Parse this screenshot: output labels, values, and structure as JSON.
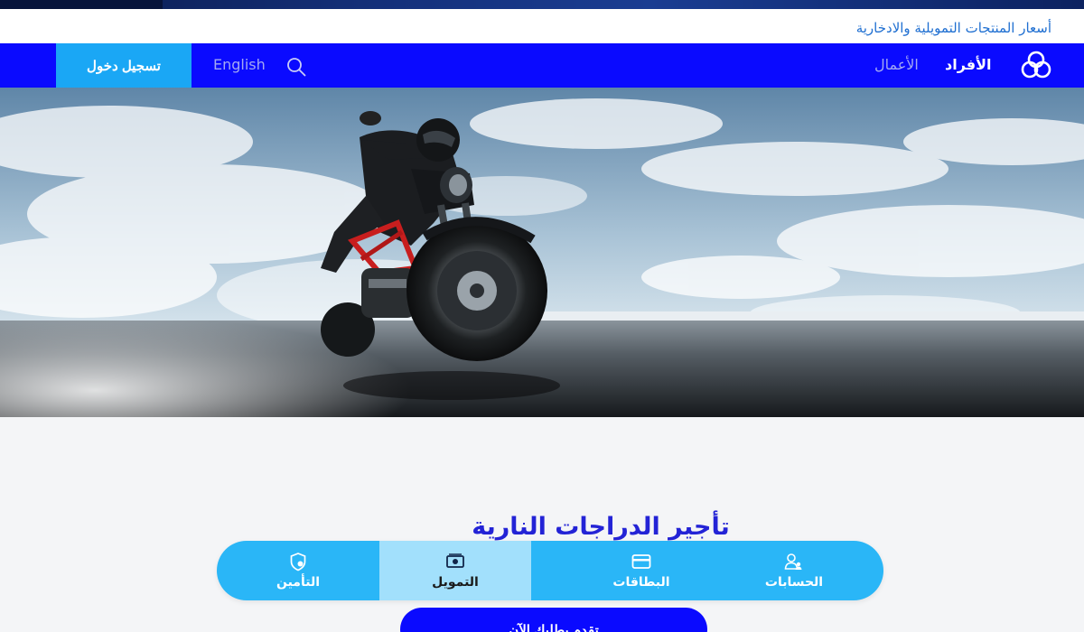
{
  "utility": {
    "rates_link": "أسعار المنتجات التمويلية والادخارية"
  },
  "nav": {
    "individuals": "الأفراد",
    "business": "الأعمال",
    "language": "English",
    "login": "تسجيل دخول"
  },
  "section": {
    "title": "تأجير الدراجات النارية",
    "cta": "تقدم بطلبك الآن"
  },
  "tabbar": {
    "accounts": "الحسابات",
    "cards": "البطاقات",
    "finance": "التمويل",
    "insurance": "التأمين"
  },
  "colors": {
    "nav_bg": "#0a0aff",
    "accent_blue": "#1aa7f5",
    "title_blue": "#2323d6",
    "tabbar_bg": "#2ab6f7",
    "tab_selected_bg": "#a2e0fc"
  },
  "icons": {
    "logo": "bank-logo-icon",
    "search": "search-icon",
    "accounts": "users-icon",
    "cards": "credit-card-icon",
    "finance": "banknote-icon",
    "insurance": "shield-icon"
  },
  "hero": {
    "image": "motorcycle rider on road under cloudy sky"
  }
}
